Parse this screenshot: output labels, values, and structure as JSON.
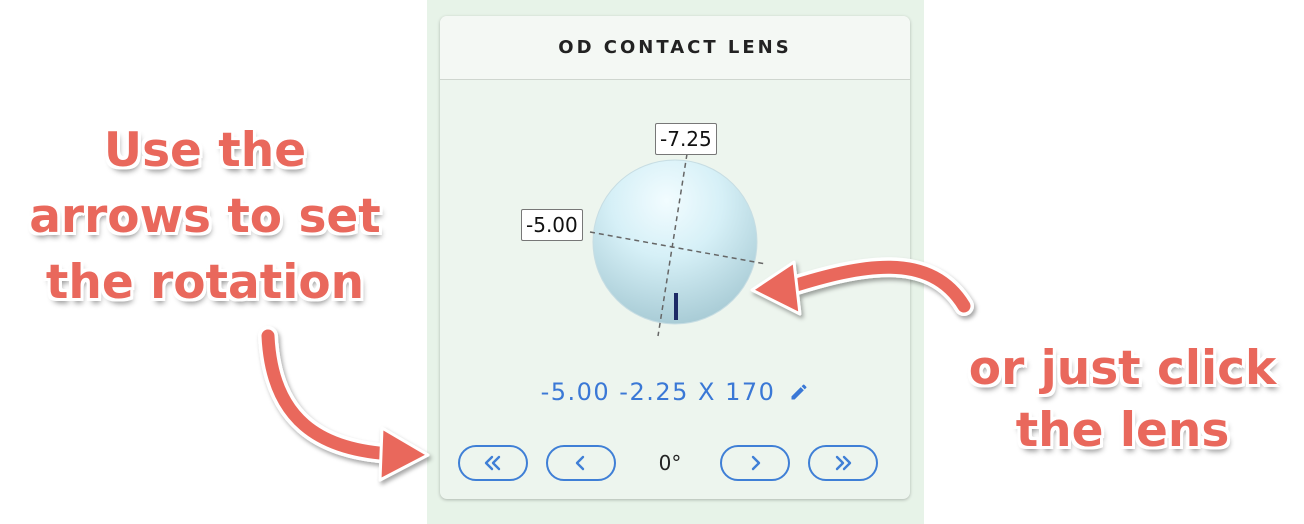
{
  "card": {
    "title": "OD CONTACT LENS",
    "lens": {
      "top_power": "-7.25",
      "left_power": "-5.00",
      "axis_degrees": 170,
      "mark_color": "#1c2a66"
    },
    "prescription": "-5.00 -2.25 X 170",
    "edit_icon": "pencil-icon",
    "rotation": {
      "value": "0°",
      "buttons": [
        {
          "name": "rotate-left-fast-button",
          "icon": "double-chevron-left-icon"
        },
        {
          "name": "rotate-left-button",
          "icon": "chevron-left-icon"
        },
        {
          "name": "rotate-right-button",
          "icon": "chevron-right-icon"
        },
        {
          "name": "rotate-right-fast-button",
          "icon": "double-chevron-right-icon"
        }
      ]
    }
  },
  "annotations": {
    "left_lines": [
      "Use the",
      "arrows to set",
      "the rotation"
    ],
    "right_lines": [
      "or just click",
      "the lens"
    ]
  },
  "colors": {
    "accent": "#3f7fd6",
    "annotation": "#e9685c",
    "panel_bg": "#e7f3e8"
  }
}
